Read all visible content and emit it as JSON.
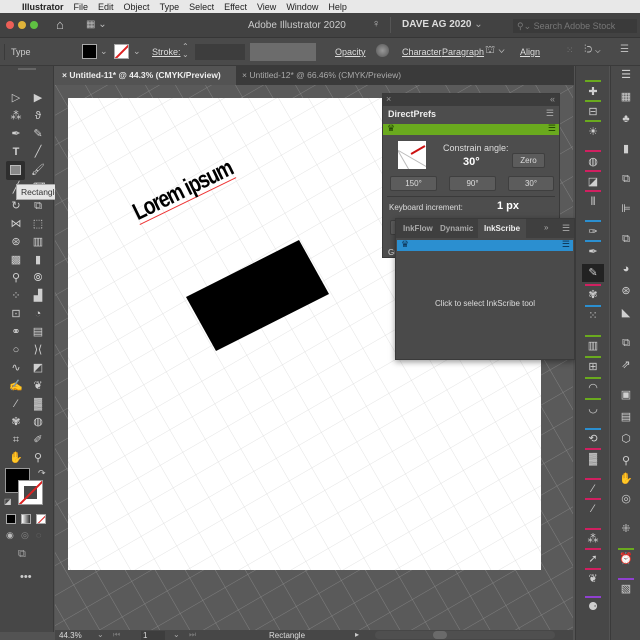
{
  "menubar": {
    "app_name": "Illustrator",
    "items": [
      "File",
      "Edit",
      "Object",
      "Type",
      "Select",
      "Effect",
      "View",
      "Window",
      "Help"
    ]
  },
  "titlebar": {
    "title": "Adobe Illustrator 2020",
    "workspace": "DAVE AG 2020",
    "search_placeholder": "Search Adobe Stock"
  },
  "controlbar": {
    "selection_type": "Type",
    "stroke_label": "Stroke:",
    "opacity_label": "Opacity",
    "character_label": "Character",
    "paragraph_label": "Paragraph",
    "align_label": "Align"
  },
  "tabs": [
    {
      "label": "Untitled-11* @ 44.3% (CMYK/Preview)",
      "active": true
    },
    {
      "label": "Untitled-12* @ 66.46% (CMYK/Preview)",
      "active": false
    }
  ],
  "tooltip": "Rectangle Tool (M)",
  "artboard": {
    "text": "Lorem ipsum",
    "shape": "rectangle",
    "fill_color": "#000000"
  },
  "directprefs": {
    "title": "DirectPrefs",
    "accent": "#6aaa1e",
    "constrain_label": "Constrain angle:",
    "constrain_value": "30°",
    "zero_button": "Zero",
    "angle_buttons": [
      "150°",
      "90°",
      "30°"
    ],
    "keyboard_label": "Keyboard increment:",
    "keyboard_value": "1 px",
    "partial_label": "Gu"
  },
  "inkpanel": {
    "tabs": [
      "InkFlow",
      "Dynamic",
      "InkScribe"
    ],
    "active_tab": "InkScribe",
    "accent": "#2b8fd0",
    "message": "Click to select InkScribe tool"
  },
  "statusbar": {
    "zoom": "44.3%",
    "artboard_number": "1",
    "current_tool": "Rectangle"
  }
}
